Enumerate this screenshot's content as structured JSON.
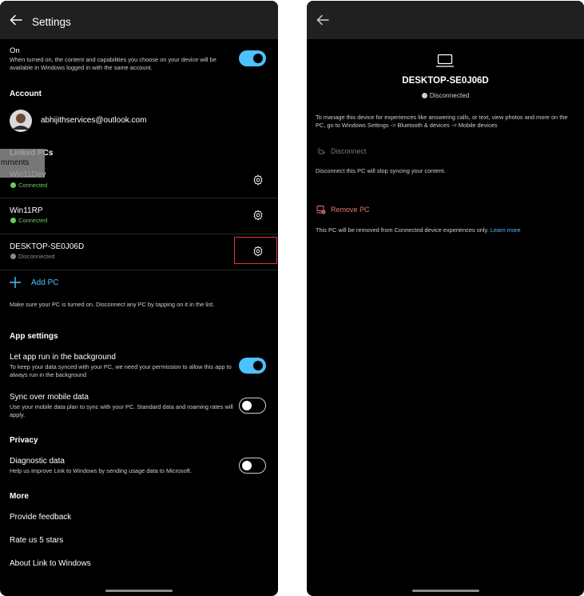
{
  "left": {
    "title": "Settings",
    "sync": {
      "label": "On",
      "description": "When turned on, the content and capabilities you choose on your device will be available in Windows logged in with the same account.",
      "enabled": true
    },
    "account": {
      "heading": "Account",
      "email": "abhijithservices@outlook.com"
    },
    "linked_pcs": {
      "heading": "Linked PCs",
      "items": [
        {
          "name": "Win11Dev",
          "status": "Connected"
        },
        {
          "name": "Win11RP",
          "status": "Connected"
        },
        {
          "name": "DESKTOP-SE0J06D",
          "status": "Disconnected"
        }
      ],
      "add_label": "Add PC",
      "hint": "Make sure your PC is turned on. Disconnect any PC by tapping on it in the list."
    },
    "app_settings": {
      "heading": "App settings",
      "background": {
        "label": "Let app run in the background",
        "description": "To keep your data synced with your PC, we need your permission to allow this app to always run in the background",
        "enabled": true
      },
      "mobile_data": {
        "label": "Sync over mobile data",
        "description": "Use your mobile data plan to sync with your PC. Standard data and roaming rates will apply.",
        "enabled": false
      }
    },
    "privacy": {
      "heading": "Privacy",
      "diagnostic": {
        "label": "Diagnostic data",
        "description": "Help us improve Link to Windows by sending usage data to Microsoft.",
        "enabled": false
      }
    },
    "more": {
      "heading": "More",
      "items": [
        "Provide feedback",
        "Rate us 5 stars",
        "About Link to Windows"
      ]
    },
    "overlay_text": "mments"
  },
  "right": {
    "device_name": "DESKTOP-SE0J06D",
    "status": "Disconnected",
    "manage_text": "To manage this device for experiences like answering calls, or text, view photos and more on the PC, go to Windows Settings -> Bluetooth & devices -> Mobile devices",
    "disconnect": {
      "label": "Disconnect",
      "description": "Disconnect this PC will stop syncing your content."
    },
    "remove": {
      "label": "Remove PC",
      "description": "This PC will be removed from Connected device experiences only.",
      "learn_more": "Learn more"
    }
  },
  "colors": {
    "accent": "#4cc2ff",
    "connected": "#6ccb5f",
    "remove": "#e8786b",
    "highlight": "#e0323c"
  }
}
